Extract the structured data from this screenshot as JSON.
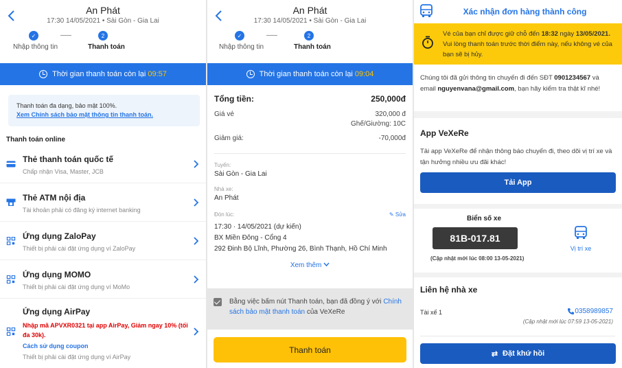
{
  "payment_screen": {
    "operator": "An Phát",
    "trip": "17:30 14/05/2021 • Sài Gòn - Gia Lai",
    "step1_label": "Nhập thông tin",
    "step2_num": "2",
    "step2_label": "Thanh toán",
    "timer_label": "Thời gian thanh toán còn lại",
    "timer_value": "09:57",
    "info_text": "Thanh toán đa dạng, bảo mật 100%.",
    "info_link": "Xem Chính sách bảo mật thông tin thanh toán.",
    "section_title": "Thanh toán online",
    "methods": [
      {
        "title": "Thẻ thanh toán quốc tế",
        "desc": "Chấp nhận Visa, Master, JCB"
      },
      {
        "title": "Thẻ ATM nội địa",
        "desc": "Tài khoản phải có đăng ký internet banking"
      },
      {
        "title": "Ứng dụng ZaloPay",
        "desc": "Thiết bị phải cài đặt ứng dụng ví ZaloPay"
      },
      {
        "title": "Ứng dụng MOMO",
        "desc": "Thiết bị phải cài đặt ứng dụng ví MoMo"
      },
      {
        "title": "Ứng dụng AirPay",
        "desc": "Thiết bị phải cài đặt ứng dụng ví AirPay"
      }
    ],
    "airpay_promo": "Nhập mã APVXR0321 tại app AirPay, Giảm ngay 10% (tối đa 30k).",
    "airpay_howto": "Cách sử dụng coupon"
  },
  "summary_screen": {
    "operator": "An Phát",
    "trip": "17:30 14/05/2021 • Sài Gòn - Gia Lai",
    "step1_label": "Nhập thông tin",
    "step2_num": "2",
    "step2_label": "Thanh toán",
    "timer_label": "Thời gian thanh toán còn lại",
    "timer_value": "09:04",
    "total_label": "Tổng tiền:",
    "total_value": "250,000đ",
    "fare_label": "Giá vé",
    "fare_value": "320,000 đ",
    "seat": "Ghế/Giường: 10C",
    "discount_label": "Giảm giá:",
    "discount_value": "-70,000đ",
    "route_label": "Tuyến:",
    "route_value": "Sài Gòn - Gia Lai",
    "operator_label": "Nhà xe:",
    "operator_value": "An Phát",
    "pickup_label": "Đón lúc:",
    "edit_label": "Sửa",
    "pickup_time": "17:30 · 14/05/2021 (dự kiến)",
    "pickup_place": "BX Miền Đông - Cổng 4",
    "pickup_address": "292 Đinh Bộ Lĩnh, Phường 26, Bình Thạnh, Hồ Chí Minh",
    "see_more": "Xem thêm",
    "agree_text": "Bằng việc bấm nút Thanh toán, bạn đã đồng ý với",
    "agree_link": "Chính sách bảo mật thanh toán",
    "agree_suffix": "của VeXeRe",
    "pay_button": "Thanh toán"
  },
  "confirm_screen": {
    "title": "Xác nhận đơn hàng thành công",
    "warn_1": "Vé của bạn chỉ được giữ chỗ đến",
    "warn_time": "18:32",
    "warn_2": "ngày",
    "warn_date": "13/05/2021.",
    "warn_3": "Vui lòng thanh toán trước thời điểm này, nếu không vé của bạn sẽ bị hủy.",
    "sent_1": "Chúng tôi đã gửi thông tin chuyến đi đến SĐT",
    "phone": "0901234567",
    "sent_2": "và email",
    "email": "nguyenvana@gmail.com",
    "sent_3": ", bạn hãy kiểm tra thật kĩ nhé!",
    "app_title": "App VeXeRe",
    "app_desc": "Tải app VeXeRe để nhận thông báo chuyến đi, theo dõi vị trí xe và tận hưởng nhiều ưu đãi khác!",
    "app_button": "Tải App",
    "plate_label": "Biển số xe",
    "plate": "81B-017.81",
    "plate_updated": "(Cập nhật mới lúc 08:00 13-05-2021)",
    "location_label": "Vị trí xe",
    "contact_title": "Liên hệ nhà xe",
    "driver_label": "Tài xế 1",
    "driver_phone": "0358989857",
    "driver_updated": "(Cập nhật mới lúc 07:59 13-05-2021)",
    "rebook_button": "Đặt khứ hồi"
  },
  "colors": {
    "primary": "#2474e5",
    "yellow": "#ffc107",
    "promo_red": "#e00000",
    "dark_blue": "#1a5bbf"
  }
}
